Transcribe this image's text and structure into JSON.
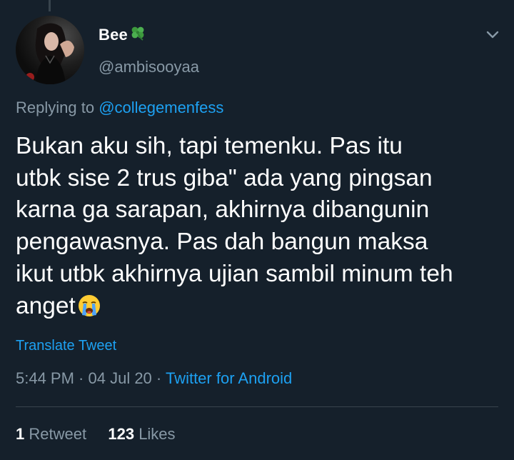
{
  "author": {
    "display_name": "Bee",
    "name_emoji": "four-leaf-clover-icon",
    "handle": "@ambisooyaa"
  },
  "reply": {
    "prefix": "Replying to ",
    "mention": "@collegemenfess"
  },
  "body": {
    "lines": [
      "Bukan aku sih, tapi temenku. Pas itu",
      "utbk sise 2 trus giba\" ada yang pingsan",
      "karna ga sarapan, akhirnya dibangunin",
      "pengawasnya. Pas dah bangun maksa",
      "ikut utbk akhirnya ujian sambil minum teh",
      "anget"
    ],
    "trailing_emoji": "loudly-crying-face-icon"
  },
  "translate_label": "Translate Tweet",
  "meta": {
    "time": "5:44 PM",
    "separator": " · ",
    "date": "04 Jul 20",
    "source": "Twitter for Android"
  },
  "stats": {
    "retweets_count": "1",
    "retweets_label": "Retweet",
    "likes_count": "123",
    "likes_label": "Likes"
  },
  "colors": {
    "background": "#15202b",
    "primary_text": "#ffffff",
    "secondary_text": "#8899a6",
    "accent": "#1da1f2",
    "divider": "#38444d"
  }
}
